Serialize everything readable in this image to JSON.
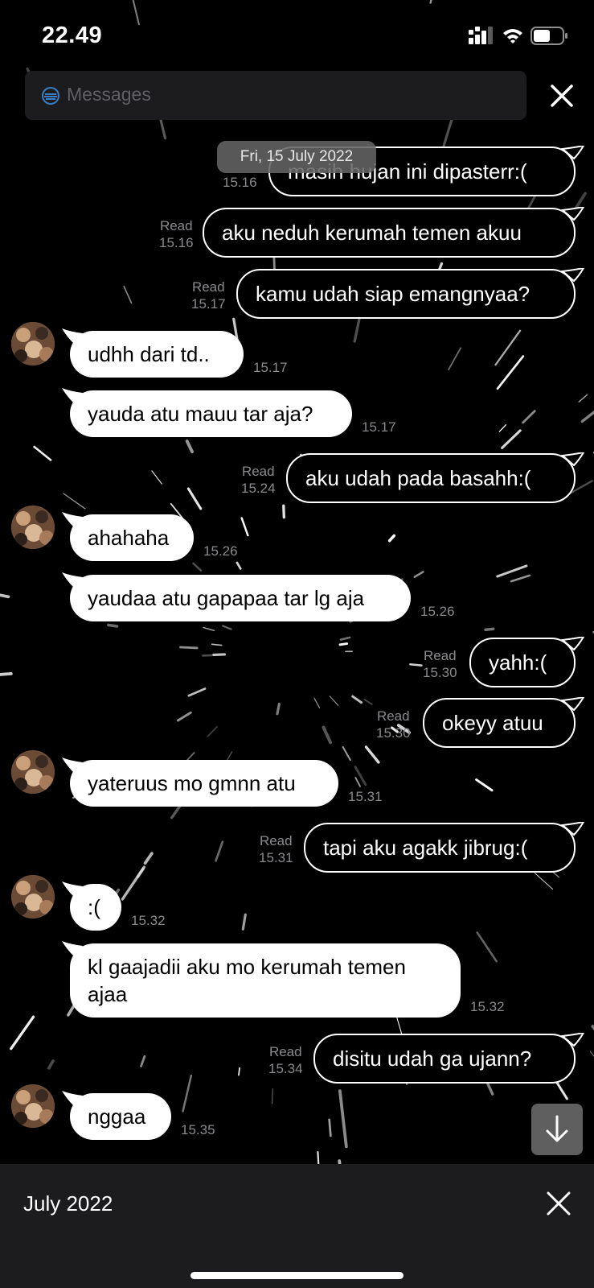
{
  "status_bar": {
    "time": "22.49"
  },
  "search": {
    "placeholder": "Messages"
  },
  "date_pill": "Fri, 15 July 2022",
  "messages": [
    {
      "dir": "out",
      "text": "masih hujan ini dipasterr:(",
      "status": "",
      "time": "15.16"
    },
    {
      "dir": "out",
      "text": "aku neduh kerumah temen akuu",
      "status": "Read",
      "time": "15.16"
    },
    {
      "dir": "out",
      "text": "kamu udah siap emangnyaa?",
      "status": "Read",
      "time": "15.17"
    },
    {
      "dir": "in",
      "text": "udhh dari td..",
      "time": "15.17"
    },
    {
      "dir": "in",
      "text": "yauda atu mauu tar aja?",
      "time": "15.17"
    },
    {
      "dir": "out",
      "text": "aku udah pada basahh:(",
      "status": "Read",
      "time": "15.24"
    },
    {
      "dir": "in",
      "text": "ahahaha",
      "time": "15.26"
    },
    {
      "dir": "in",
      "text": "yaudaa atu gapapaa tar lg aja",
      "time": "15.26"
    },
    {
      "dir": "out",
      "text": "yahh:(",
      "status": "Read",
      "time": "15.30"
    },
    {
      "dir": "out",
      "text": "okeyy atuu",
      "status": "Read",
      "time": "15.30"
    },
    {
      "dir": "in",
      "text": "yateruus mo gmnn atu",
      "time": "15.31"
    },
    {
      "dir": "out",
      "text": "tapi aku agakk jibrug:(",
      "status": "Read",
      "time": "15.31"
    },
    {
      "dir": "in",
      "text": ":(",
      "time": "15.32"
    },
    {
      "dir": "in",
      "text": "kl gaajadii aku mo kerumah temen ajaa",
      "time": "15.32"
    },
    {
      "dir": "out",
      "text": "disitu udah ga ujann?",
      "status": "Read",
      "time": "15.34"
    },
    {
      "dir": "in",
      "text": "nggaa",
      "time": "15.35"
    }
  ],
  "bottom_panel": {
    "title": "July 2022"
  },
  "colors": {
    "background": "#000000",
    "bubble_in": "#ffffff",
    "panel": "#1c1c1e",
    "meta_text": "#8a8a8e"
  },
  "icons": [
    "signal-icon",
    "wifi-icon",
    "battery-icon",
    "messages-search-icon",
    "close-icon",
    "chevron-down-arrow-icon"
  ]
}
